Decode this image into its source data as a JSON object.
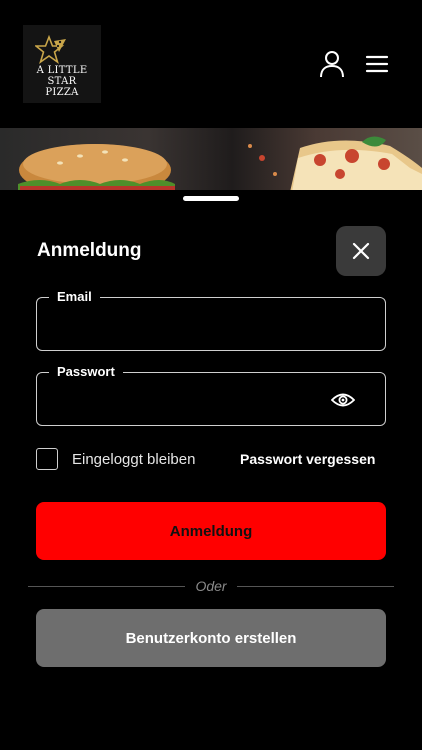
{
  "header": {
    "logo_lines": [
      "A LITTLE",
      "STAR",
      "PIZZA"
    ],
    "icons": {
      "account": "user-icon",
      "menu": "hamburger-menu-icon"
    }
  },
  "login": {
    "title": "Anmeldung",
    "close_icon": "close-icon",
    "email_label": "Email",
    "email_value": "",
    "password_label": "Passwort",
    "password_value": "",
    "password_visibility_icon": "eye-icon",
    "remember_label": "Eingeloggt bleiben",
    "remember_checked": false,
    "forgot_label": "Passwort vergessen",
    "submit_label": "Anmeldung",
    "divider_label": "Oder",
    "create_account_label": "Benutzerkonto erstellen"
  },
  "colors": {
    "primary": "#ff0000",
    "secondary": "#6e6e6e",
    "background": "#000000",
    "logo_gold": "#c9a64a"
  }
}
